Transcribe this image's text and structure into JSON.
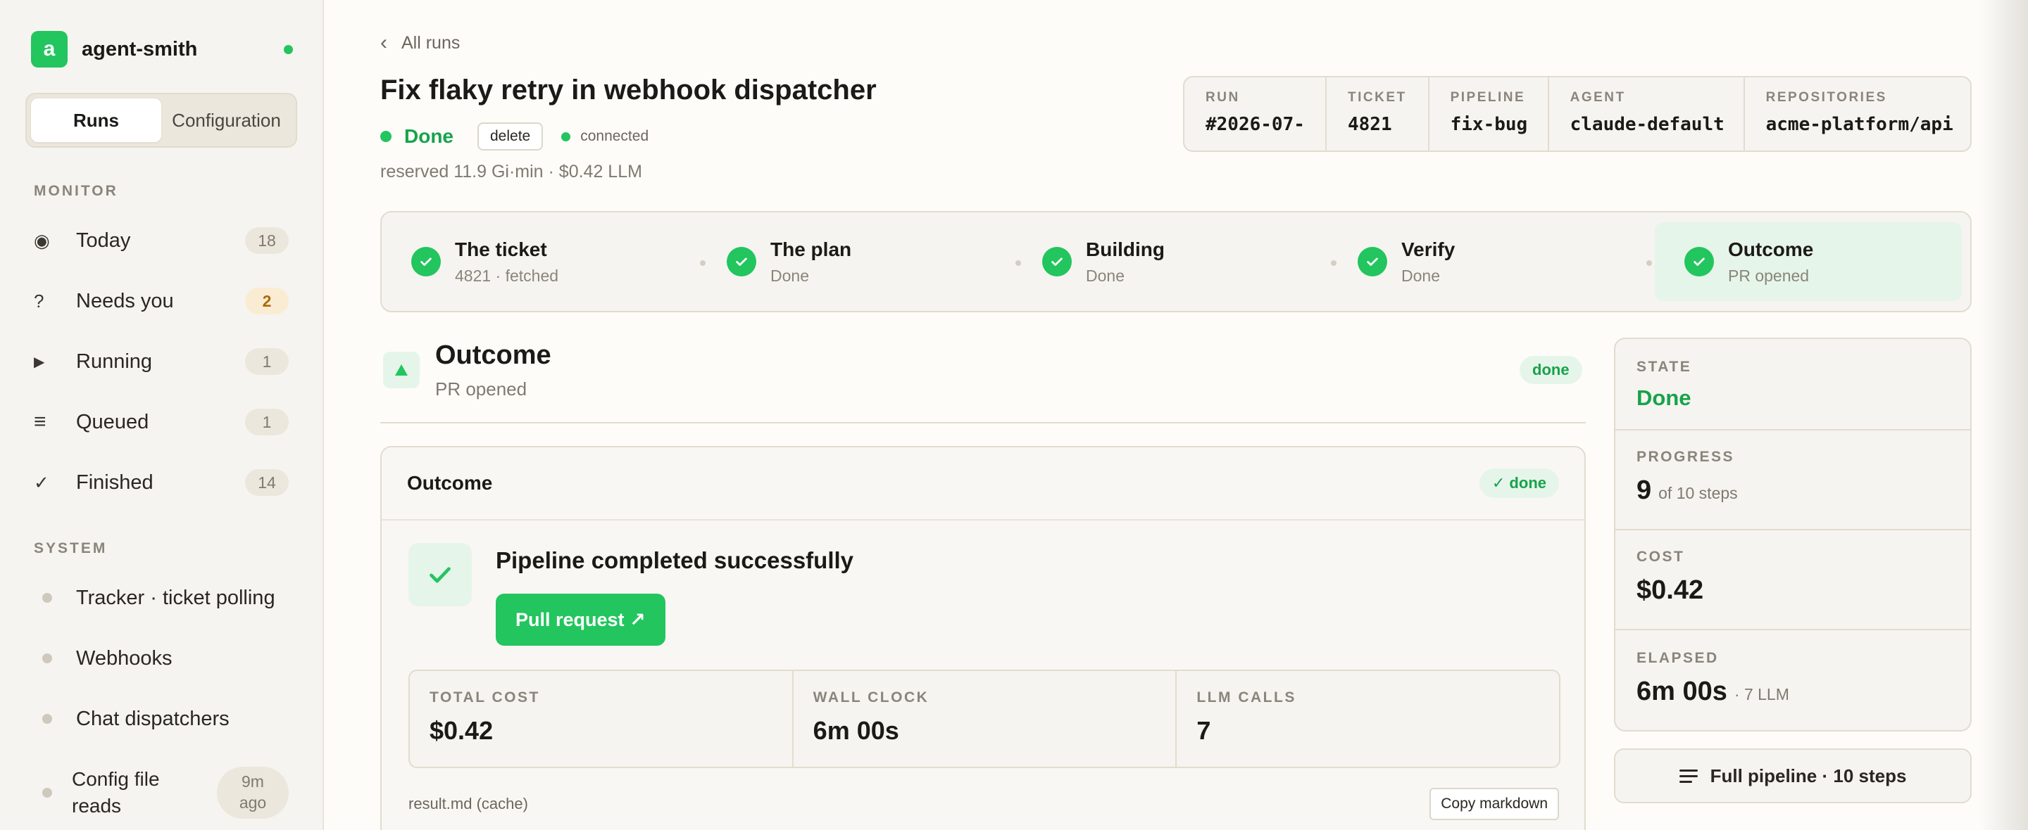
{
  "sidebar": {
    "brand_letter": "a",
    "brand_name": "agent-smith",
    "tabs": [
      {
        "label": "Runs",
        "active": true
      },
      {
        "label": "Configuration",
        "active": false
      }
    ],
    "monitor_label": "MONITOR",
    "monitor_items": [
      {
        "icon": "radio-target-icon",
        "glyph": "◉",
        "label": "Today",
        "count": "18"
      },
      {
        "icon": "question-icon",
        "glyph": "?",
        "label": "Needs you",
        "count": "2"
      },
      {
        "icon": "play-icon",
        "glyph": "▶",
        "label": "Running",
        "count": "1"
      },
      {
        "icon": "queue-icon",
        "glyph": "≡",
        "label": "Queued",
        "count": "1"
      },
      {
        "icon": "checkmark-icon",
        "glyph": "✓",
        "label": "Finished",
        "count": "14"
      }
    ],
    "system_label": "SYSTEM",
    "system_items": [
      {
        "label": "Tracker · ticket polling"
      },
      {
        "label": "Webhooks"
      },
      {
        "label": "Chat dispatchers"
      },
      {
        "label_line1": "Config file",
        "label_line2": "reads",
        "ago_line1": "9m",
        "ago_line2": "ago"
      }
    ]
  },
  "header": {
    "back_label": "All runs",
    "title": "Fix flaky retry in webhook dispatcher",
    "status": "Done",
    "delete_label": "delete",
    "connection": "connected",
    "reserved": "reserved 11.9 Gi·min · $0.42 LLM"
  },
  "meta": [
    {
      "key": "RUN",
      "value": "#2026-07-"
    },
    {
      "key": "TICKET",
      "value": "4821"
    },
    {
      "key": "PIPELINE",
      "value": "fix-bug"
    },
    {
      "key": "AGENT",
      "value": "claude-default"
    },
    {
      "key": "REPOSITORIES",
      "value": "acme-platform/api"
    }
  ],
  "steps": [
    {
      "title": "The ticket",
      "sub": "4821 · fetched"
    },
    {
      "title": "The plan",
      "sub": "Done"
    },
    {
      "title": "Building",
      "sub": "Done"
    },
    {
      "title": "Verify",
      "sub": "Done"
    },
    {
      "title": "Outcome",
      "sub": "PR opened"
    }
  ],
  "outcome": {
    "title": "Outcome",
    "subtitle": "PR opened",
    "badge": "done",
    "card_title": "Outcome",
    "card_badge": "✓ done",
    "success_title": "Pipeline completed successfully",
    "pr_button": "Pull request ↗",
    "stats": [
      {
        "key": "TOTAL COST",
        "value": "$0.42"
      },
      {
        "key": "WALL CLOCK",
        "value": "6m 00s"
      },
      {
        "key": "LLM CALLS",
        "value": "7"
      }
    ],
    "cache_label": "result.md (cache)",
    "copy_label": "Copy markdown"
  },
  "side": {
    "state_key": "STATE",
    "state_value": "Done",
    "progress_key": "PROGRESS",
    "progress_value": "9",
    "progress_suffix": "of 10 steps",
    "cost_key": "COST",
    "cost_value": "$0.42",
    "elapsed_key": "ELAPSED",
    "elapsed_value": "6m 00s",
    "elapsed_suffix": "· 7 LLM",
    "pipeline_button": "Full pipeline · 10 steps"
  },
  "colors": {
    "accent": "#22c55e",
    "accent_dark": "#16a34a",
    "warn": "#a96b0b"
  }
}
